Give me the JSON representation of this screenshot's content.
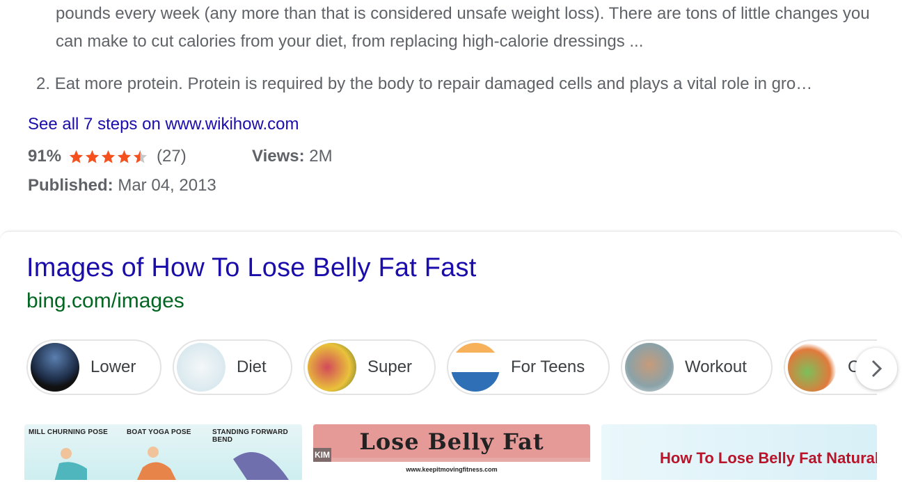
{
  "step1": {
    "text": "pounds every week (any more than that is considered unsafe weight loss). There are tons of little changes you can make to cut calories from your diet, from replacing high-calorie dressings ..."
  },
  "step2": {
    "number": "2.",
    "text": "Eat more protein. Protein is required by the body to repair damaged cells and plays a vital role in gro…"
  },
  "see_all_link": "See all 7 steps on www.wikihow.com",
  "rating": {
    "percent": "91%",
    "count": "(27)",
    "stars_value": 4.5,
    "star_color": "#f4511e"
  },
  "views": {
    "label": "Views:",
    "value": "2M"
  },
  "published": {
    "label": "Published:",
    "value": "Mar 04, 2013"
  },
  "images_section": {
    "title": "Images of How To Lose Belly Fat Fast",
    "source": "bing.com/images",
    "chips": [
      {
        "label": "Lower"
      },
      {
        "label": "Diet"
      },
      {
        "label": "Super"
      },
      {
        "label": "For Teens"
      },
      {
        "label": "Workout"
      },
      {
        "label": "C"
      }
    ],
    "next_icon": "chevron-right-icon",
    "tiles": {
      "tile1_labels": [
        "MILL CHURNING POSE",
        "BOAT YOGA POSE",
        "STANDING FORWARD BEND"
      ],
      "tile2_title": "Lose Belly Fat",
      "tile2_site": "www.keepitmovingfitness.com",
      "tile2_logo": "KIM",
      "tile3_title": "How To Lose Belly Fat Naturally &"
    }
  },
  "colors": {
    "link": "#1a0dab",
    "url_green": "#006621",
    "text_gray": "#5f6368"
  }
}
